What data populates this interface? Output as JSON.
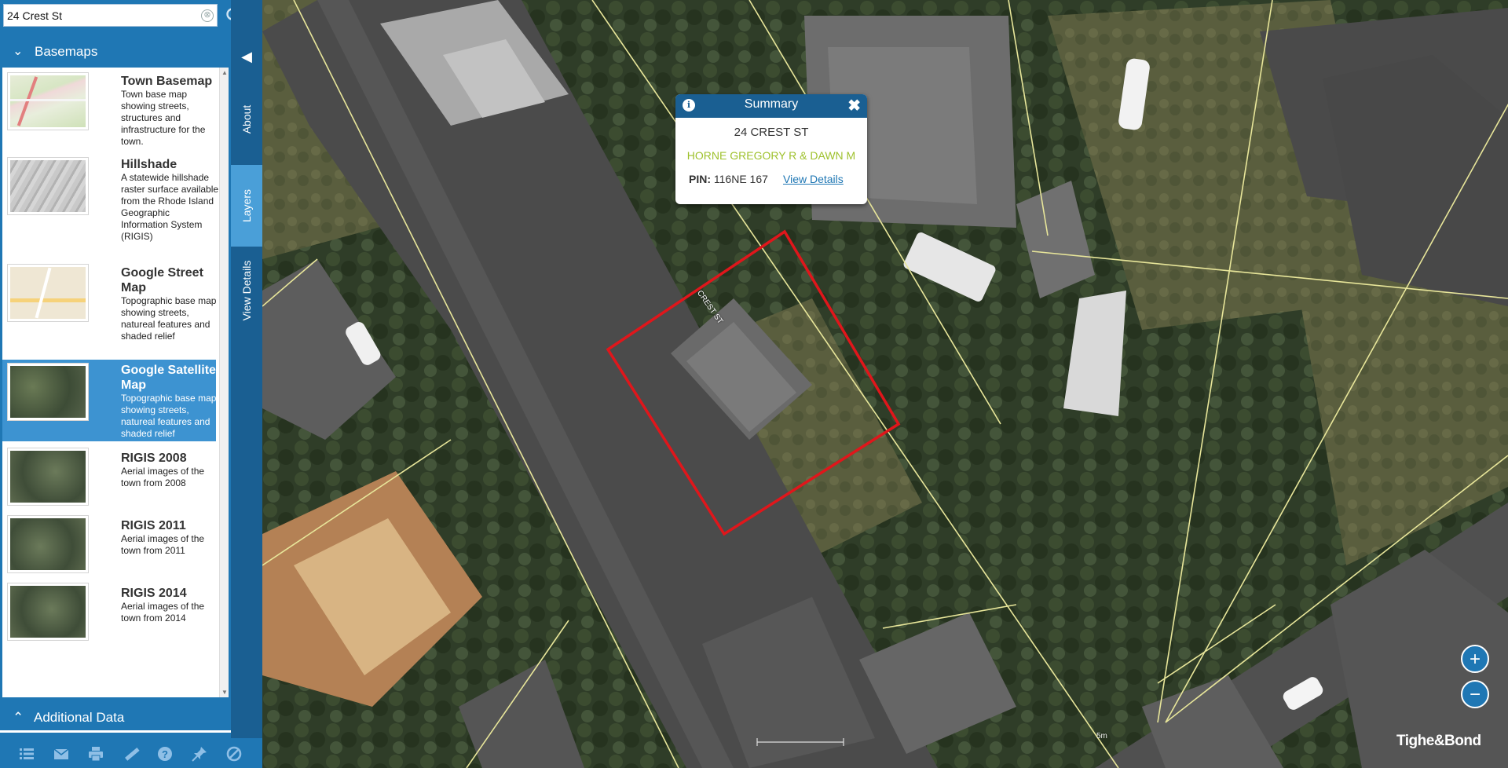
{
  "search": {
    "value": "24 Crest St",
    "clear_glyph": "⊗"
  },
  "panel": {
    "basemaps_label": "Basemaps",
    "additional_label": "Additional Data",
    "collapse_glyph": "◀",
    "tabs": [
      {
        "label": "About",
        "active": false
      },
      {
        "label": "Layers",
        "active": true
      },
      {
        "label": "View Details",
        "active": false
      }
    ],
    "basemaps": [
      {
        "title": "Town Basemap",
        "desc": "Town base map showing streets, structures and infrastructure for the town.",
        "thumb": "town-basemap",
        "selected": false
      },
      {
        "title": "Hillshade",
        "desc": "A statewide hillshade raster surface available from the Rhode Island Geographic Information System (RIGIS)",
        "thumb": "hillshade",
        "selected": false
      },
      {
        "title": "Google Street Map",
        "desc": "Topographic base map showing streets, natureal features and shaded relief",
        "thumb": "street-map",
        "selected": false
      },
      {
        "title": "Google Satellite Map",
        "desc": "Topographic base map showing streets, natureal features and shaded relief",
        "thumb": "satellite",
        "selected": true
      },
      {
        "title": "RIGIS 2008",
        "desc": "Aerial images of the town from 2008",
        "thumb": "satellite",
        "selected": false
      },
      {
        "title": "RIGIS 2011",
        "desc": "Aerial images of the town from 2011",
        "thumb": "satellite",
        "selected": false
      },
      {
        "title": "RIGIS 2014",
        "desc": "Aerial images of the town from 2014",
        "thumb": "satellite",
        "selected": false
      }
    ]
  },
  "toolbar": [
    "list-icon",
    "mail-icon",
    "print-icon",
    "measure-icon",
    "help-icon",
    "pin-icon",
    "clear-icon"
  ],
  "popup": {
    "title": "Summary",
    "address": "24 CREST ST",
    "owner": "HORNE GREGORY R & DAWN M",
    "pin_label": "PIN:",
    "pin_value": "116NE 167",
    "details_link": "View Details"
  },
  "map": {
    "road_label": "CREST ST",
    "scale_label": "5m",
    "zoom_in": "+",
    "zoom_out": "−",
    "brand": "Tighe&Bond",
    "colors": {
      "parcel_lines": "#e8e69a",
      "selected_parcel": "#e0161b",
      "panel": "#1f77b4"
    }
  }
}
